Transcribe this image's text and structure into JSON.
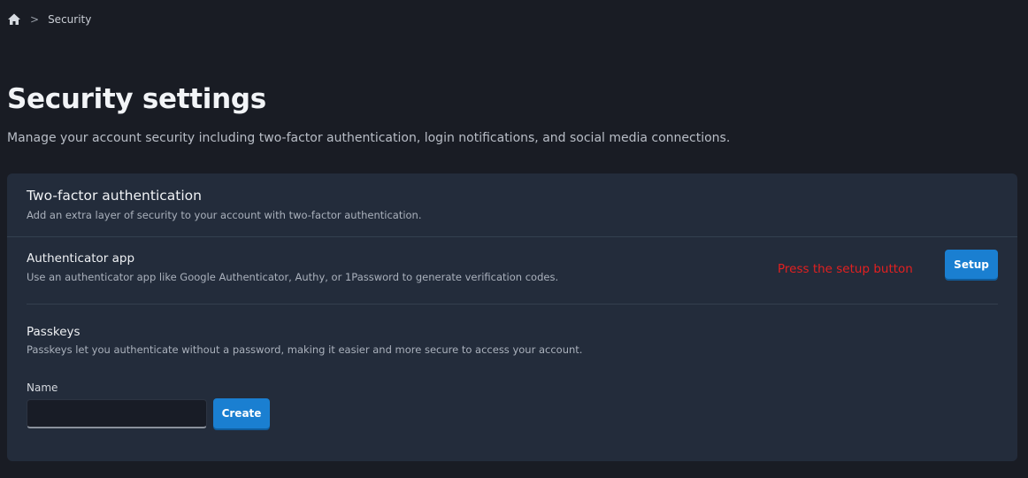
{
  "breadcrumb": {
    "home_icon": "home-icon",
    "separator": ">",
    "current": "Security"
  },
  "page": {
    "title": "Security settings",
    "description": "Manage your account security including two-factor authentication, login notifications, and social media connections."
  },
  "two_factor": {
    "title": "Two-factor authentication",
    "subtitle": "Add an extra layer of security to your account with two-factor authentication.",
    "authenticator": {
      "title": "Authenticator app",
      "description": "Use an authenticator app like Google Authenticator, Authy, or 1Password to generate verification codes.",
      "hint": "Press the setup button",
      "setup_label": "Setup"
    },
    "passkeys": {
      "title": "Passkeys",
      "description": "Passkeys let you authenticate without a password, making it easier and more secure to access your account.",
      "name_label": "Name",
      "name_value": "",
      "create_label": "Create"
    }
  },
  "colors": {
    "background": "#191c24",
    "card": "#232c3b",
    "accent": "#1a7fd1",
    "hint": "#e32020"
  }
}
